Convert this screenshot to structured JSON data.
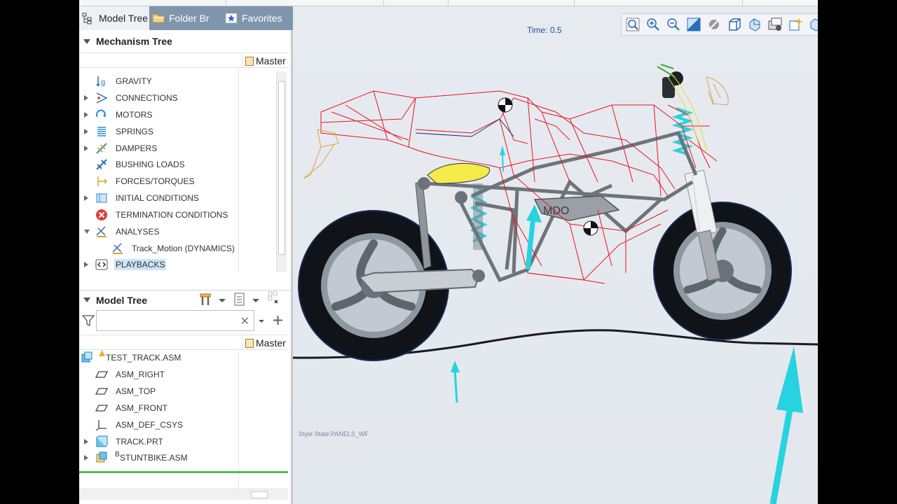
{
  "tabs": [
    {
      "label": "Model Tree",
      "icon": "model-tree-icon",
      "active": true
    },
    {
      "label": "Folder Br",
      "icon": "folder-icon",
      "active": false
    },
    {
      "label": "Favorites",
      "icon": "favorites-star-icon",
      "active": false
    }
  ],
  "mechanism_tree": {
    "title": "Mechanism Tree",
    "column": "Master",
    "items": [
      {
        "label": "GRAVITY",
        "icon": "gravity-icon",
        "expandable": false
      },
      {
        "label": "CONNECTIONS",
        "icon": "connections-icon",
        "expandable": true
      },
      {
        "label": "MOTORS",
        "icon": "motors-icon",
        "expandable": true
      },
      {
        "label": "SPRINGS",
        "icon": "springs-icon",
        "expandable": true
      },
      {
        "label": "DAMPERS",
        "icon": "dampers-icon",
        "expandable": true
      },
      {
        "label": "BUSHING LOADS",
        "icon": "bushing-loads-icon",
        "expandable": false
      },
      {
        "label": "FORCES/TORQUES",
        "icon": "forces-torques-icon",
        "expandable": false
      },
      {
        "label": "INITIAL CONDITIONS",
        "icon": "initial-conditions-icon",
        "expandable": true
      },
      {
        "label": "TERMINATION CONDITIONS",
        "icon": "termination-conditions-icon",
        "expandable": false
      },
      {
        "label": "ANALYSES",
        "icon": "analyses-icon",
        "expandable": true,
        "expanded": true
      },
      {
        "label": "Track_Motion (DYNAMICS)",
        "icon": "analysis-item-icon",
        "expandable": false,
        "child": true
      },
      {
        "label": "PLAYBACKS",
        "icon": "playbacks-icon",
        "expandable": true,
        "selected": true
      }
    ]
  },
  "model_tree": {
    "title": "Model Tree",
    "column": "Master",
    "search_value": "",
    "items": [
      {
        "label": "TEST_TRACK.ASM",
        "icon": "assembly-icon",
        "root": true
      },
      {
        "label": "ASM_RIGHT",
        "icon": "datum-plane-icon"
      },
      {
        "label": "ASM_TOP",
        "icon": "datum-plane-icon"
      },
      {
        "label": "ASM_FRONT",
        "icon": "datum-plane-icon"
      },
      {
        "label": "ASM_DEF_CSYS",
        "icon": "csys-icon"
      },
      {
        "label": "TRACK.PRT",
        "icon": "part-icon",
        "expandable": true
      },
      {
        "label": "STUNTBIKE.ASM",
        "icon": "assembly-icon",
        "expandable": true,
        "prefix": "B"
      }
    ]
  },
  "viewport": {
    "time_label": "Time: 0.5",
    "style_state": "Style State:PANELS_WF",
    "frame_logo": "MDO"
  },
  "colors": {
    "wireframe": "#e8141c",
    "force_arrow": "#27d3e0",
    "tab_bar": "#7f95ab",
    "selection": "#cce4f7"
  }
}
